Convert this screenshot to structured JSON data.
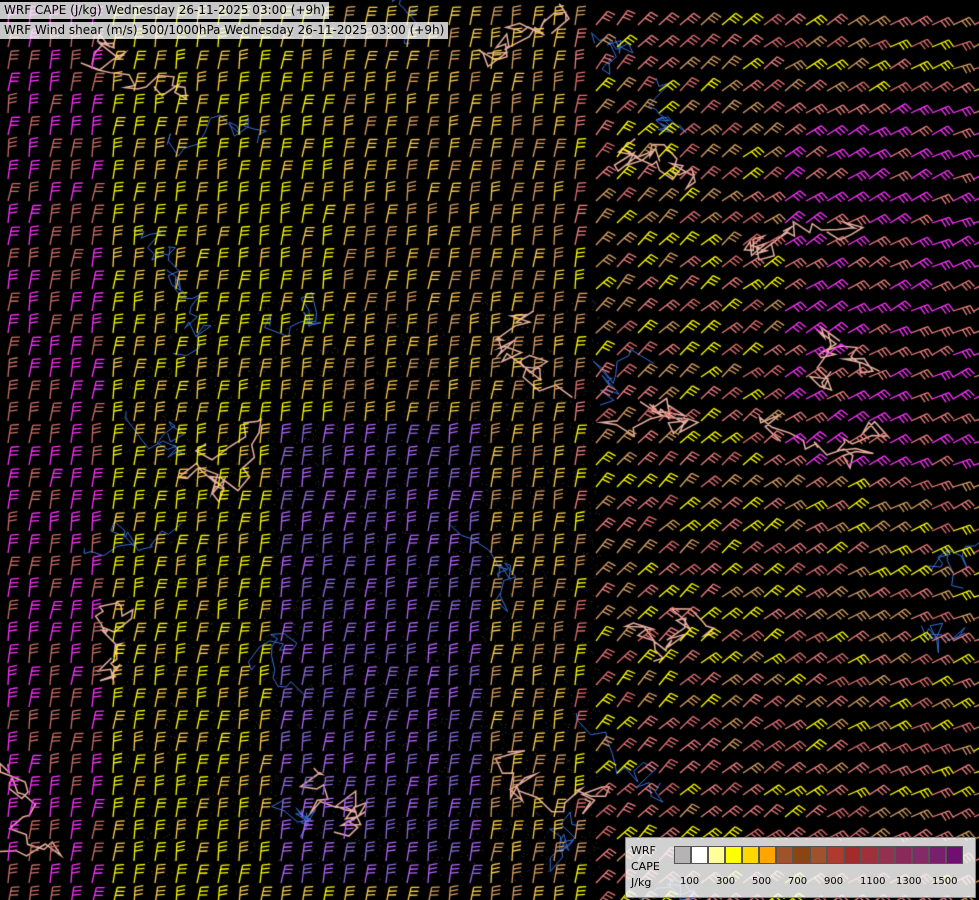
{
  "titles": {
    "line1": "WRF CAPE (J/kg) Wednesday 26-11-2025 03:00 (+9h)",
    "line2": "WRF Wind shear (m/s) 500/1000hPa Wednesday 26-11-2025 03:00 (+9h)"
  },
  "legend": {
    "label_model": "WRF",
    "label_var": "CAPE",
    "label_unit": "J/kg",
    "colors": [
      "#b4b4b4",
      "#ffffff",
      "#ffff99",
      "#ffff00",
      "#ffd700",
      "#ffa500",
      "#a0522d",
      "#8b4513",
      "#a0522d",
      "#b03a2e",
      "#a52a2a",
      "#a0303a",
      "#943050",
      "#8b2a5a",
      "#852a66",
      "#7a1f6e",
      "#700f70"
    ],
    "ticks": [
      "100",
      "300",
      "500",
      "700",
      "900",
      "1100",
      "1300",
      "1500"
    ]
  },
  "map": {
    "background": "#000000",
    "barb_colors": [
      "#ffff00",
      "#ffd24d",
      "#d9a066",
      "#f08080",
      "#e07070",
      "#c9706a",
      "#ff33ff",
      "#b366ff",
      "#8c6bd9"
    ],
    "border_color": "#e8b0a0",
    "river_color": "#3a6fd8"
  }
}
